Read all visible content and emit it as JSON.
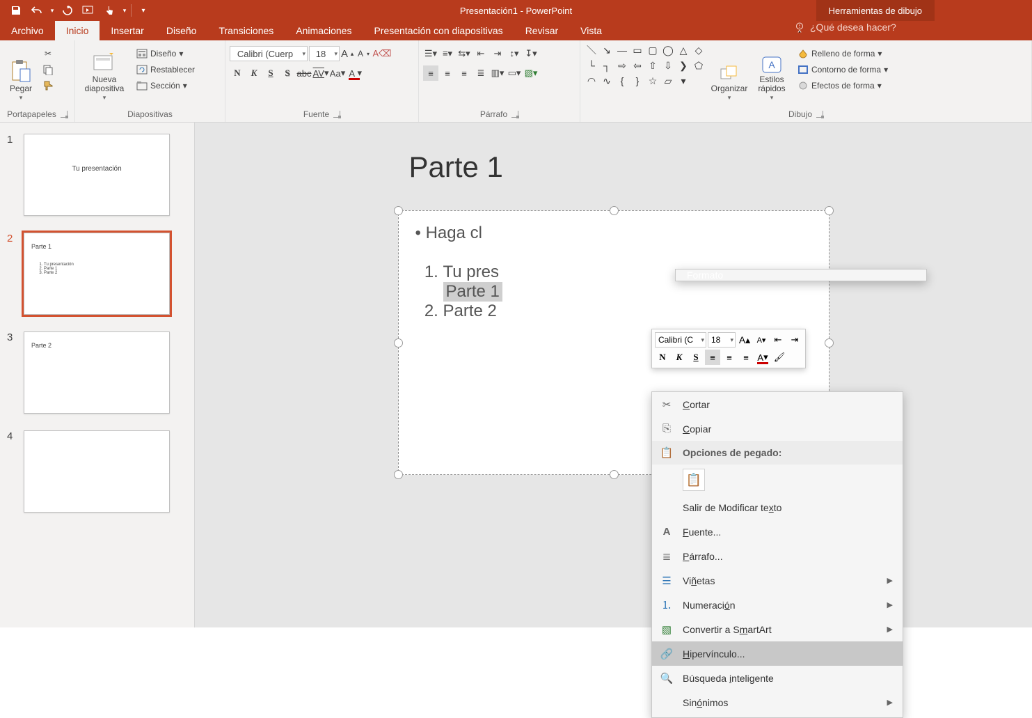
{
  "app": {
    "title": "Presentación1 - PowerPoint",
    "context_tool": "Herramientas de dibujo"
  },
  "qat": {
    "save": "save-icon",
    "undo": "undo-icon",
    "redo": "redo-icon",
    "start": "start-from-beginning-icon",
    "touch": "touch-mode-icon"
  },
  "tabs": {
    "file": "Archivo",
    "home": "Inicio",
    "insert": "Insertar",
    "design": "Diseño",
    "transitions": "Transiciones",
    "animations": "Animaciones",
    "slideshow": "Presentación con diapositivas",
    "review": "Revisar",
    "view": "Vista",
    "format": "Formato",
    "tellme": "¿Qué desea hacer?"
  },
  "ribbon": {
    "clipboard": {
      "label": "Portapapeles",
      "paste": "Pegar"
    },
    "slides": {
      "label": "Diapositivas",
      "new_slide": "Nueva diapositiva",
      "layout": "Diseño",
      "reset": "Restablecer",
      "section": "Sección"
    },
    "font": {
      "label": "Fuente",
      "name": "Calibri (Cuerp",
      "size": "18",
      "bold": "N",
      "italic": "K",
      "underline": "S",
      "shadow": "S",
      "strike": "abc",
      "spacing": "AV",
      "case": "Aa",
      "color": "A"
    },
    "paragraph": {
      "label": "Párrafo"
    },
    "drawing": {
      "label": "Dibujo",
      "arrange": "Organizar",
      "quick_styles": "Estilos rápidos",
      "fill": "Relleno de forma",
      "outline": "Contorno de forma",
      "effects": "Efectos de forma"
    }
  },
  "thumbs": {
    "s1_title": "Tu presentación",
    "s2_title": "Parte 1",
    "s2_items": [
      "Tu presentación",
      "Parte 1",
      "Parte 2"
    ],
    "s3_title": "Parte 2"
  },
  "slide": {
    "title": "Parte 1",
    "bullet_prompt": "Haga cl",
    "items": [
      "Tu pres",
      "Parte 1",
      "Parte 2"
    ]
  },
  "mini": {
    "font": "Calibri (C",
    "size": "18",
    "bold": "N",
    "italic": "K",
    "underline": "S",
    "color": "A"
  },
  "context_menu": {
    "cut": "Cortar",
    "copy": "Copiar",
    "paste_header": "Opciones de pegado:",
    "exit_edit": "Salir de Modificar texto",
    "font": "Fuente...",
    "paragraph": "Párrafo...",
    "bullets": "Viñetas",
    "numbering": "Numeración",
    "smartart": "Convertir a SmartArt",
    "hyperlink": "Hipervínculo...",
    "smart_lookup": "Búsqueda inteligente",
    "synonyms": "Sinónimos"
  }
}
